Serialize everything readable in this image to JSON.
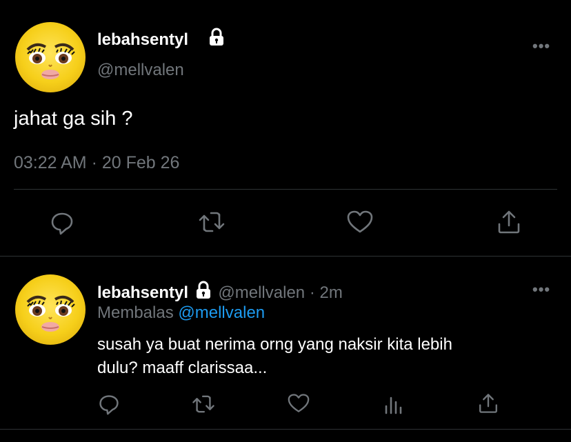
{
  "main_tweet": {
    "display_name": "lebahsentyl",
    "handle": "@mellvalen",
    "text": "jahat ga sih ?",
    "time": "03:22 AM",
    "separator": "·",
    "date": "20 Feb 26",
    "more_label": "•••",
    "actions": [
      "reply-icon",
      "retweet-icon",
      "like-icon",
      "share-icon"
    ]
  },
  "reply_tweet": {
    "display_name": "lebahsentyl",
    "handle": "@mellvalen",
    "separator": "·",
    "age": "2m",
    "replying_prefix": "Membalas",
    "replying_to": "@mellvalen",
    "text_line1": "susah ya buat nerima orng yang naksir kita lebih",
    "text_line2": "dulu? maaff clarissaa...",
    "more_label": "•••",
    "actions": [
      "reply-icon",
      "retweet-icon",
      "like-icon",
      "analytics-icon",
      "share-icon"
    ]
  },
  "colors": {
    "background": "#000000",
    "primary_text": "#e7e9ea",
    "secondary_text": "#71767b",
    "link": "#1d9bf0",
    "divider": "#2f3336"
  }
}
